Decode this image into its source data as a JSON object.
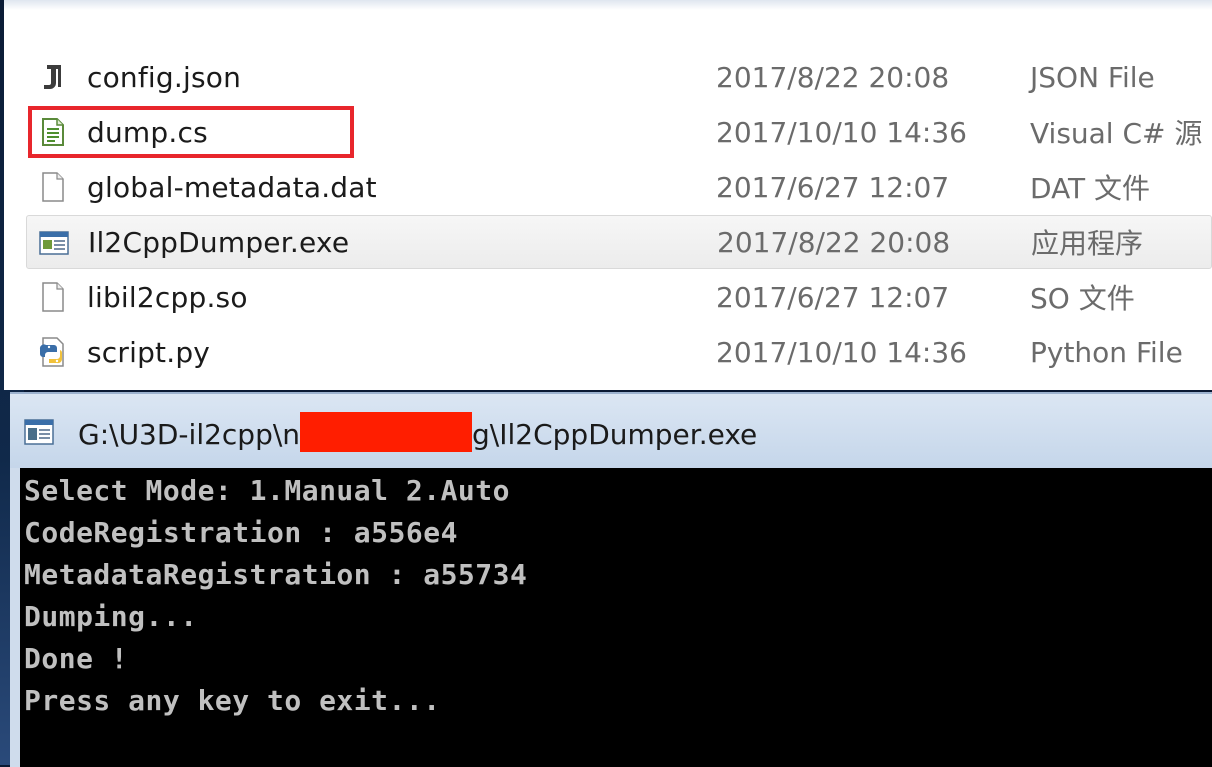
{
  "files": [
    {
      "name": "config.json",
      "date": "2017/8/22 20:08",
      "type": "JSON File",
      "icon": "json-file-icon"
    },
    {
      "name": "dump.cs",
      "date": "2017/10/10 14:36",
      "type": "Visual C# 源",
      "icon": "csharp-file-icon"
    },
    {
      "name": "global-metadata.dat",
      "date": "2017/6/27 12:07",
      "type": "DAT 文件",
      "icon": "blank-file-icon"
    },
    {
      "name": "Il2CppDumper.exe",
      "date": "2017/8/22 20:08",
      "type": "应用程序",
      "icon": "exe-file-icon"
    },
    {
      "name": "libil2cpp.so",
      "date": "2017/6/27 12:07",
      "type": "SO 文件",
      "icon": "blank-file-icon"
    },
    {
      "name": "script.py",
      "date": "2017/10/10 14:36",
      "type": "Python File",
      "icon": "python-file-icon"
    }
  ],
  "highlight_color": "#e8262c",
  "console": {
    "title_prefix": "G:\\U3D-il2cpp\\n",
    "title_suffix": "g\\Il2CppDumper.exe",
    "lines": [
      "Select Mode: 1.Manual 2.Auto",
      "CodeRegistration : a556e4",
      "MetadataRegistration : a55734",
      "Dumping...",
      "Done !",
      "Press any key to exit..."
    ]
  }
}
